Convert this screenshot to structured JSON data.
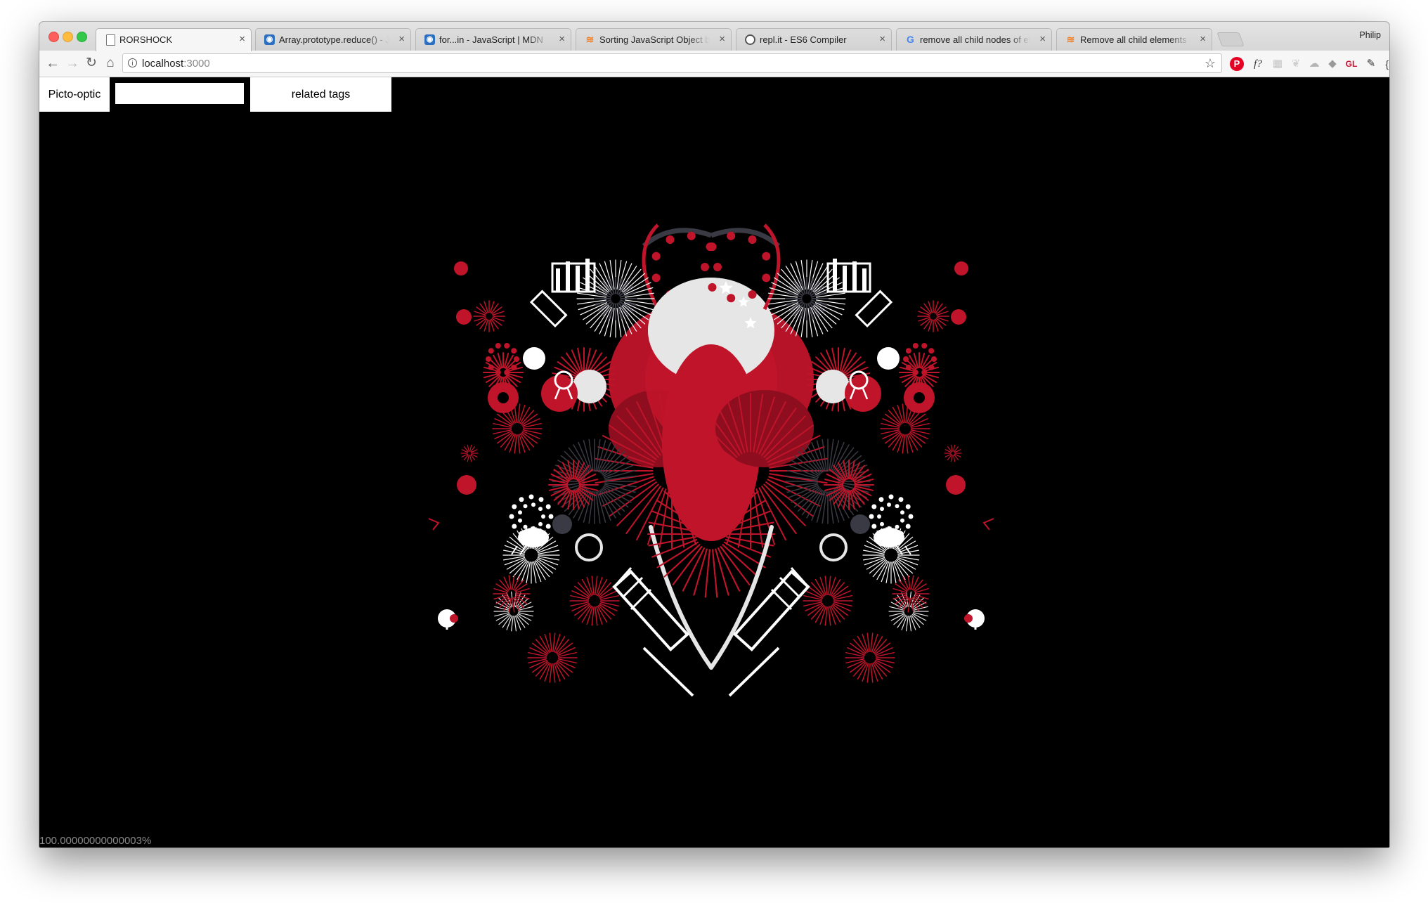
{
  "browser": {
    "profile_name": "Philip",
    "tabs": [
      {
        "title": "RORSHOCK",
        "icon": "page-icon",
        "active": true
      },
      {
        "title": "Array.prototype.reduce() - JavaScript | MDN",
        "icon": "mdn-icon",
        "active": false
      },
      {
        "title": "for...in - JavaScript | MDN",
        "icon": "mdn-icon",
        "active": false
      },
      {
        "title": "Sorting JavaScript Object by property value",
        "icon": "stackoverflow-icon",
        "active": false
      },
      {
        "title": "repl.it - ES6 Compiler",
        "icon": "replit-icon",
        "active": false
      },
      {
        "title": "remove all child nodes of element",
        "icon": "google-icon",
        "active": false
      },
      {
        "title": "Remove all child elements of a DOM node",
        "icon": "stackoverflow-icon",
        "active": false
      }
    ],
    "address": {
      "host": "localhost",
      "port": ":3000"
    }
  },
  "page": {
    "app_title": "Picto-optic",
    "search": {
      "value": "",
      "placeholder": ""
    },
    "related_button_label": "related tags",
    "zoom_readout": "100.00000000000003%"
  },
  "colors": {
    "accent_red": "#c0142a",
    "dark_red": "#8e0d1e",
    "light_gray": "#e6e6e6",
    "slate": "#3a3a44",
    "background": "#000000"
  }
}
